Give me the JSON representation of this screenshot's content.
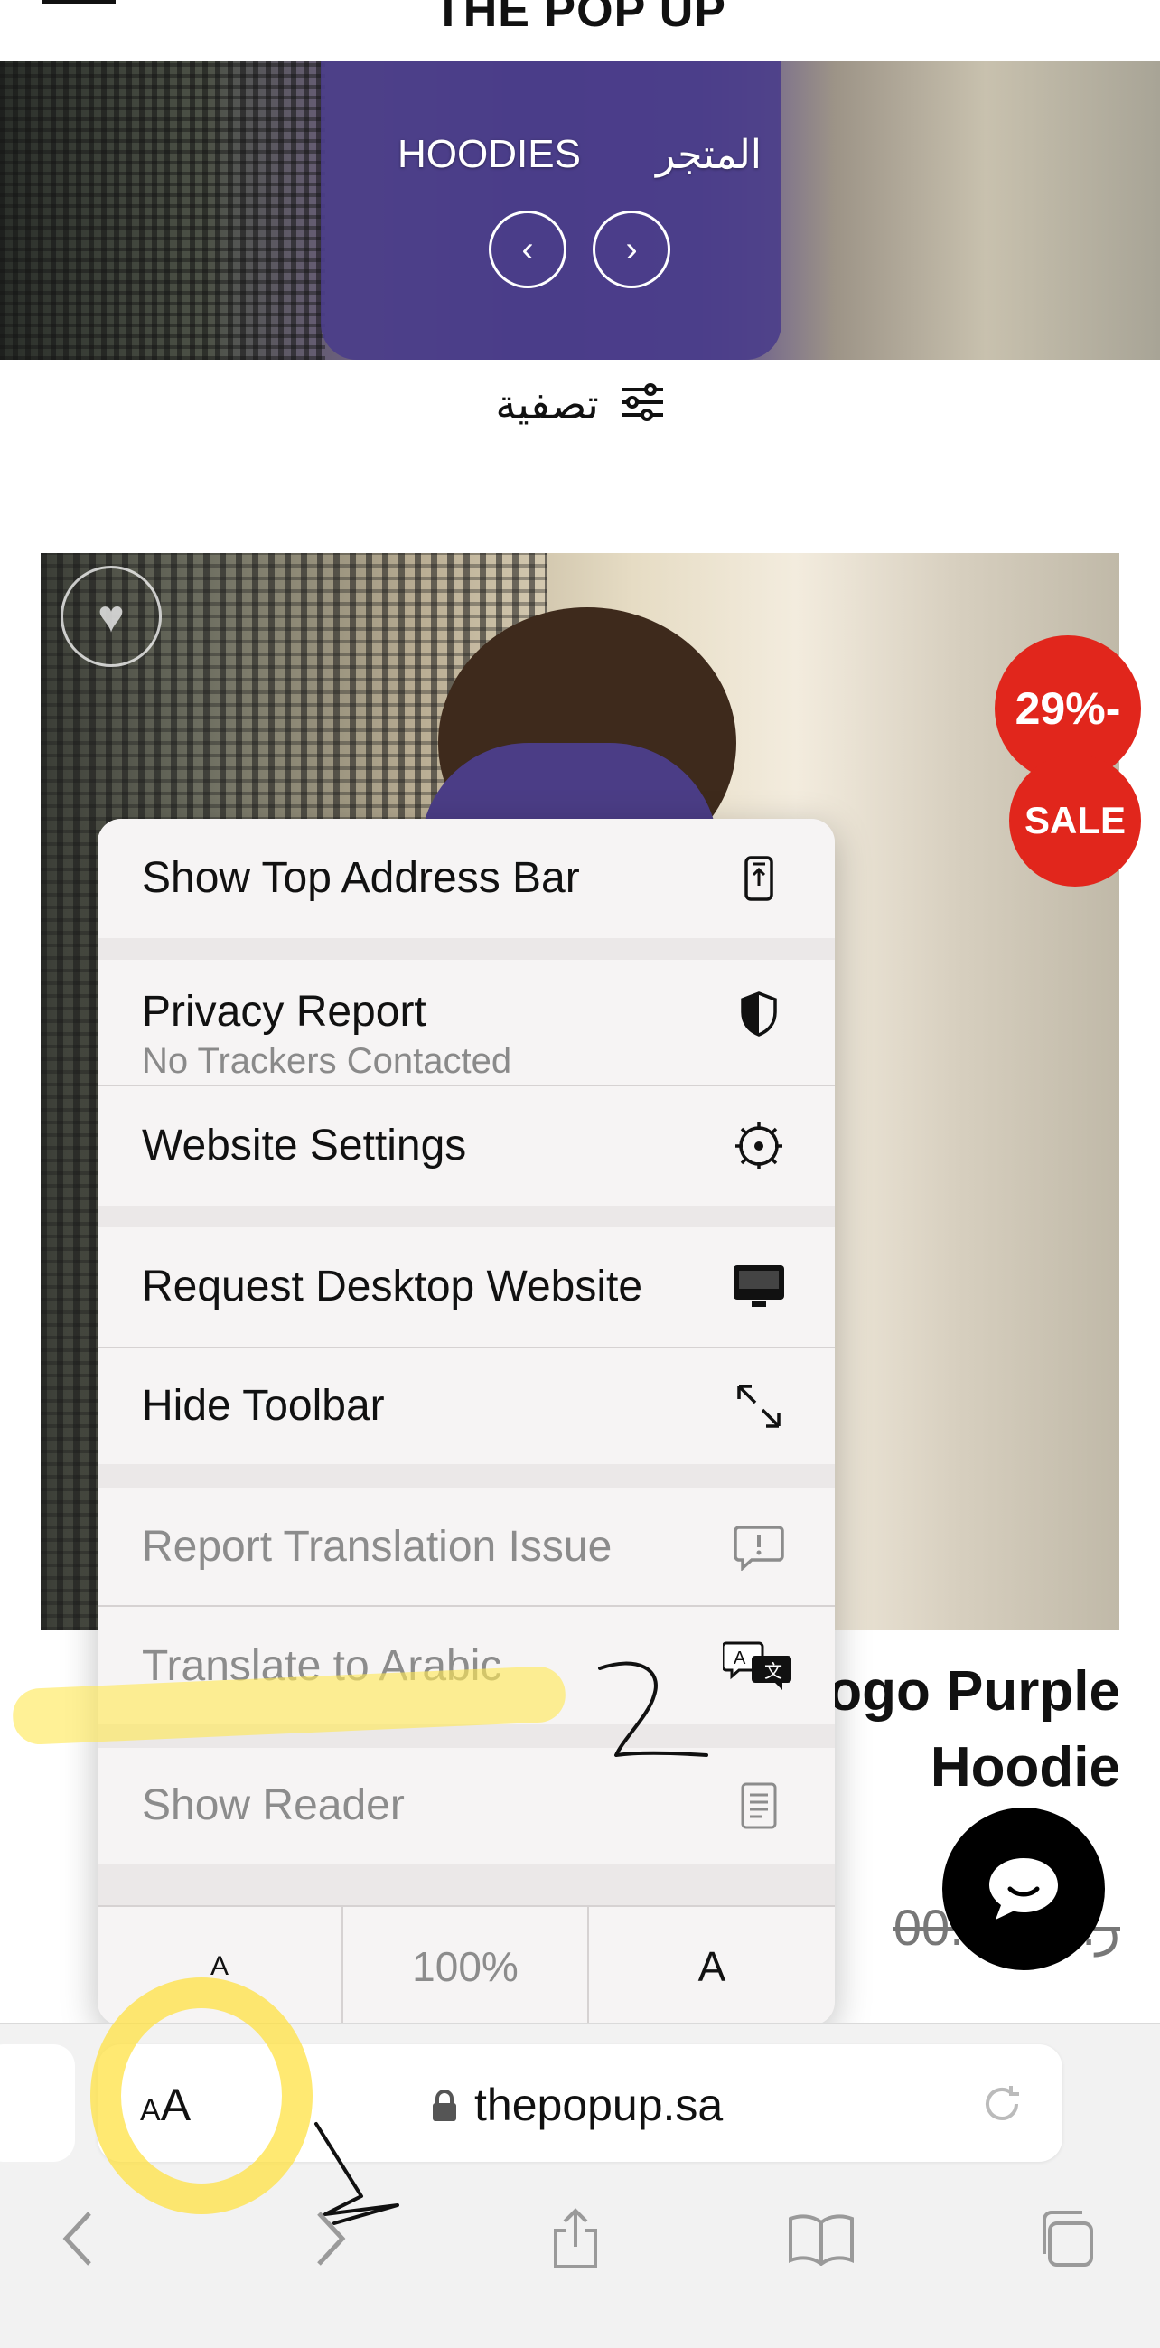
{
  "header": {
    "brand": "THE POP UP"
  },
  "hero": {
    "crumb_store": "المتجر",
    "crumb_category": "HOODIES",
    "prev_glyph": "‹",
    "next_glyph": "›"
  },
  "filter": {
    "label": "تصفية",
    "icon": "sliders-icon"
  },
  "product": {
    "badge_discount": "29%-",
    "badge_sale": "SALE",
    "title_line1": "ogo Purple",
    "title_line2": "Hoodie",
    "price": "ر.س 2  .00",
    "wishlist_icon": "heart-icon",
    "chat_icon": "chat-bubble-icon"
  },
  "menu": {
    "show_top_address_bar": "Show Top Address Bar",
    "privacy_report": "Privacy Report",
    "privacy_sub": "No Trackers Contacted",
    "website_settings": "Website Settings",
    "request_desktop": "Request Desktop Website",
    "hide_toolbar": "Hide Toolbar",
    "report_translation": "Report Translation Issue",
    "translate_arabic": "Translate to Arabic",
    "show_reader": "Show Reader",
    "font_small": "A",
    "zoom": "100%",
    "font_large": "A"
  },
  "address_bar": {
    "aa_label": "AA",
    "url": "thepopup.sa"
  },
  "annotations": {
    "step1": "1",
    "step2": "2",
    "highlight_color": "#FFE14A"
  },
  "colors": {
    "badge_red": "#E1261C",
    "menu_bg": "#F6F4F4"
  }
}
